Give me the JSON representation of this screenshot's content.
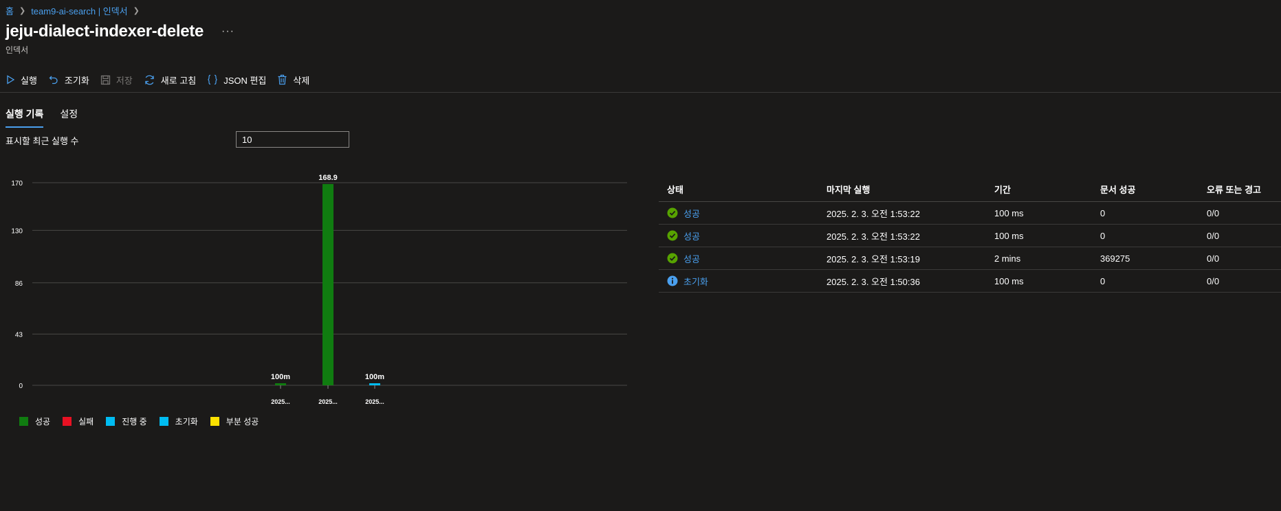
{
  "breadcrumb": {
    "home": "홈",
    "service": "team9-ai-search | 인덱서"
  },
  "header": {
    "title": "jeju-dialect-indexer-delete",
    "more": "···",
    "subtitle": "인덱서"
  },
  "toolbar": {
    "run": "실행",
    "reset": "조기화",
    "save": "저장",
    "refresh": "새로 고침",
    "edit_json": "JSON 편집",
    "delete": "삭제"
  },
  "tabs": {
    "history": "실행 기록",
    "settings": "설정"
  },
  "recent_runs": {
    "label": "표시할 최근 실행 수",
    "value": "10"
  },
  "colors": {
    "success": "#107c10",
    "failed": "#e81123",
    "in_progress": "#00bcf2",
    "reset": "#00bcf2",
    "partial": "#fce100",
    "link": "#4aa0ef"
  },
  "chart_data": {
    "type": "bar",
    "categories": [
      "2025...",
      "2025...",
      "2025..."
    ],
    "values": [
      0.1,
      168.9,
      0.1
    ],
    "data_labels": [
      "100m",
      "168.9",
      "100m"
    ],
    "series_colors": [
      "#107c10",
      "#107c10",
      "#00bcf2"
    ],
    "yticks": [
      0,
      43,
      86,
      130,
      170
    ],
    "ylim": [
      0,
      170
    ],
    "grid": true,
    "legend_position": "bottom-left",
    "legend": [
      {
        "label": "성공",
        "color": "#107c10"
      },
      {
        "label": "실패",
        "color": "#e81123"
      },
      {
        "label": "진행 중",
        "color": "#00bcf2"
      },
      {
        "label": "초기화",
        "color": "#00bcf2"
      },
      {
        "label": "부분 성공",
        "color": "#fce100"
      }
    ]
  },
  "table": {
    "headers": [
      "상태",
      "마지막 실행",
      "기간",
      "문서 성공",
      "오류 또는 경고"
    ],
    "rows": [
      {
        "status": "성공",
        "icon": "success-check-icon",
        "last_run": "2025. 2. 3. 오전 1:53:22",
        "duration": "100 ms",
        "docs": "0",
        "errors": "0/0"
      },
      {
        "status": "성공",
        "icon": "success-check-icon",
        "last_run": "2025. 2. 3. 오전 1:53:22",
        "duration": "100 ms",
        "docs": "0",
        "errors": "0/0"
      },
      {
        "status": "성공",
        "icon": "success-check-icon",
        "last_run": "2025. 2. 3. 오전 1:53:19",
        "duration": "2 mins",
        "docs": "369275",
        "errors": "0/0"
      },
      {
        "status": "초기화",
        "icon": "info-icon",
        "last_run": "2025. 2. 3. 오전 1:50:36",
        "duration": "100 ms",
        "docs": "0",
        "errors": "0/0"
      }
    ]
  }
}
